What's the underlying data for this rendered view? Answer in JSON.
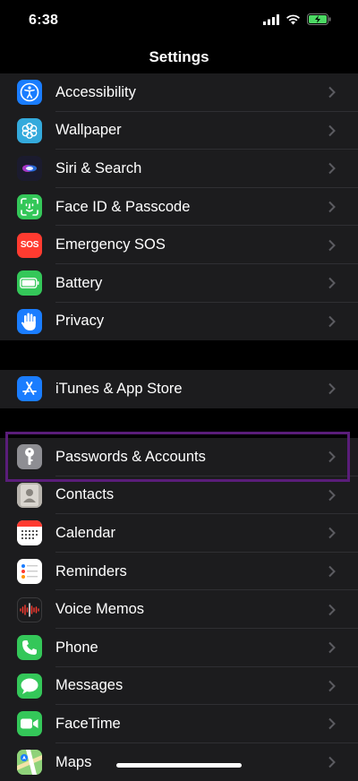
{
  "status_bar": {
    "time": "6:38"
  },
  "nav": {
    "title": "Settings"
  },
  "groups": [
    {
      "items": [
        {
          "label": "Accessibility",
          "icon": "accessibility-icon",
          "color": "#1a7dff"
        },
        {
          "label": "Wallpaper",
          "icon": "wallpaper-icon",
          "color": "#34aadc"
        },
        {
          "label": "Siri & Search",
          "icon": "siri-icon",
          "color": "#1b1b2e"
        },
        {
          "label": "Face ID & Passcode",
          "icon": "face-id-icon",
          "color": "#34c759"
        },
        {
          "label": "Emergency SOS",
          "icon": "sos-icon",
          "color": "#ff3b30",
          "text": "SOS"
        },
        {
          "label": "Battery",
          "icon": "battery-icon",
          "color": "#34c759"
        },
        {
          "label": "Privacy",
          "icon": "privacy-hand-icon",
          "color": "#1a7dff"
        }
      ]
    },
    {
      "items": [
        {
          "label": "iTunes & App Store",
          "icon": "app-store-icon",
          "color": "#1a7dff"
        }
      ]
    },
    {
      "items": [
        {
          "label": "Passwords & Accounts",
          "icon": "key-icon",
          "color": "#8e8e93"
        },
        {
          "label": "Contacts",
          "icon": "contacts-icon",
          "color": "#9a9a9a"
        },
        {
          "label": "Calendar",
          "icon": "calendar-icon",
          "color": "#ffffff"
        },
        {
          "label": "Reminders",
          "icon": "reminders-icon",
          "color": "#ffffff"
        },
        {
          "label": "Voice Memos",
          "icon": "voice-memos-icon",
          "color": "#1c1c1e"
        },
        {
          "label": "Phone",
          "icon": "phone-icon",
          "color": "#34c759"
        },
        {
          "label": "Messages",
          "icon": "messages-icon",
          "color": "#34c759"
        },
        {
          "label": "FaceTime",
          "icon": "facetime-icon",
          "color": "#34c759"
        },
        {
          "label": "Maps",
          "icon": "maps-icon",
          "color": "#6fbf5a"
        }
      ]
    }
  ],
  "highlight_color": "#5a1d7a"
}
